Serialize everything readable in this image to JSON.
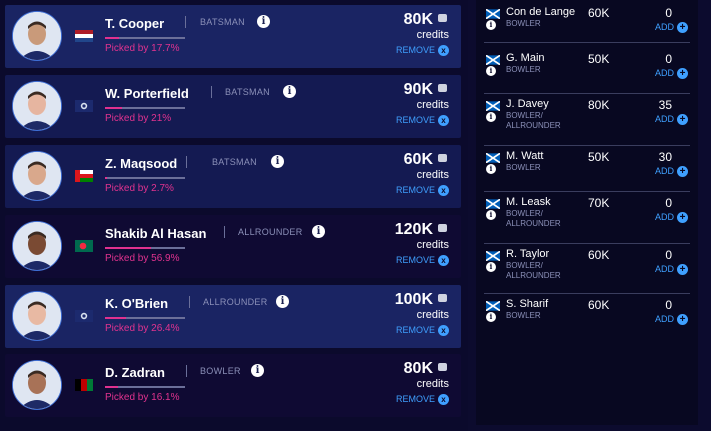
{
  "selected_players": [
    {
      "name": "T. Cooper",
      "role": "BATSMAN",
      "picked": "Picked by 17.7%",
      "picked_pct": 17.7,
      "price": "80K",
      "credits": "credits",
      "remove": "REMOVE",
      "flag": "netherlands-flag"
    },
    {
      "name": "W. Porterfield",
      "role": "BATSMAN",
      "picked": "Picked by 21%",
      "picked_pct": 21,
      "price": "90K",
      "credits": "credits",
      "remove": "REMOVE",
      "flag": "ireland-flag"
    },
    {
      "name": "Z. Maqsood",
      "role": "BATSMAN",
      "picked": "Picked by 2.7%",
      "picked_pct": 2.7,
      "price": "60K",
      "credits": "credits",
      "remove": "REMOVE",
      "flag": "oman-flag"
    },
    {
      "name": "Shakib Al Hasan",
      "role": "ALLROUNDER",
      "picked": "Picked by 56.9%",
      "picked_pct": 56.9,
      "price": "120K",
      "credits": "credits",
      "remove": "REMOVE",
      "flag": "bangladesh-flag"
    },
    {
      "name": "K. O'Brien",
      "role": "ALLROUNDER",
      "picked": "Picked by 26.4%",
      "picked_pct": 26.4,
      "price": "100K",
      "credits": "credits",
      "remove": "REMOVE",
      "flag": "ireland-flag"
    },
    {
      "name": "D. Zadran",
      "role": "BOWLER",
      "picked": "Picked by 16.1%",
      "picked_pct": 16.1,
      "price": "80K",
      "credits": "credits",
      "remove": "REMOVE",
      "flag": "afghanistan-flag"
    }
  ],
  "available_players": [
    {
      "name": "Con de Lange",
      "role": "BOWLER",
      "price": "60K",
      "points": "0",
      "add": "ADD",
      "flag": "scotland-flag"
    },
    {
      "name": "G. Main",
      "role": "BOWLER",
      "price": "50K",
      "points": "0",
      "add": "ADD",
      "flag": "scotland-flag"
    },
    {
      "name": "J. Davey",
      "role": "BOWLER/ ALLROUNDER",
      "price": "80K",
      "points": "35",
      "add": "ADD",
      "flag": "scotland-flag"
    },
    {
      "name": "M. Watt",
      "role": "BOWLER",
      "price": "50K",
      "points": "30",
      "add": "ADD",
      "flag": "scotland-flag"
    },
    {
      "name": "M. Leask",
      "role": "BOWLER/ ALLROUNDER",
      "price": "70K",
      "points": "0",
      "add": "ADD",
      "flag": "scotland-flag"
    },
    {
      "name": "R. Taylor",
      "role": "BOWLER/ ALLROUNDER",
      "price": "60K",
      "points": "0",
      "add": "ADD",
      "flag": "scotland-flag"
    },
    {
      "name": "S. Sharif",
      "role": "BOWLER",
      "price": "60K",
      "points": "0",
      "add": "ADD",
      "flag": "scotland-flag"
    }
  ],
  "icons": {
    "info": "i",
    "remove": "x",
    "add": "+"
  },
  "colors": {
    "accent": "#e2338f",
    "link": "#3fa0ff",
    "card_light": "#1a2463",
    "card_dark": "#0f0a33"
  }
}
